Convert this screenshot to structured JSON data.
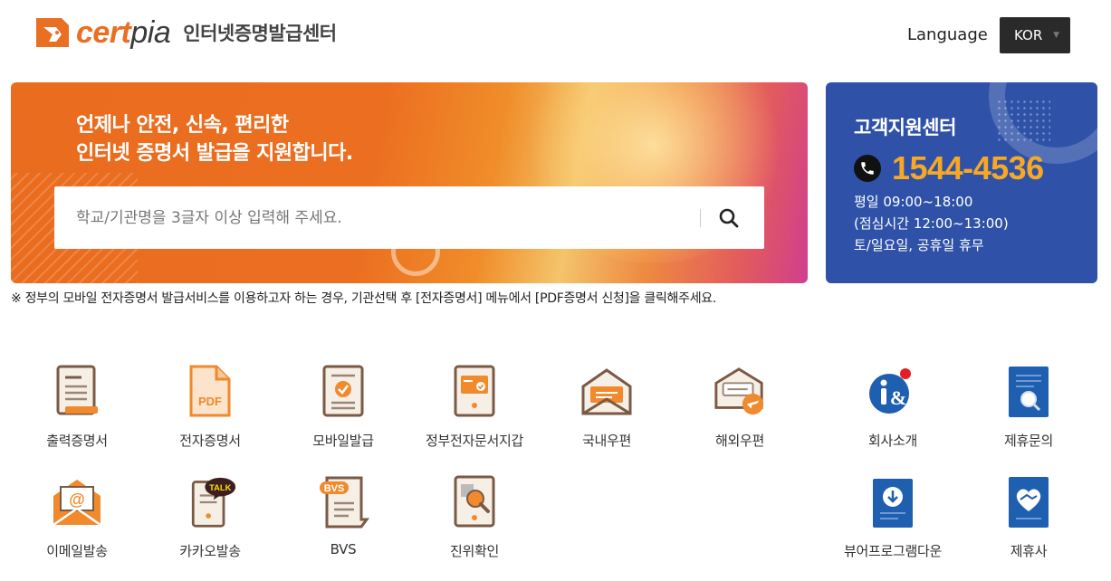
{
  "header": {
    "logo_cert": "cert",
    "logo_pia": "pia",
    "logo_subtitle": "인터넷증명발급센터",
    "language_label": "Language",
    "language_value": "KOR"
  },
  "hero": {
    "title_line1": "언제나 안전, 신속, 편리한",
    "title_line2": "인터넷 증명서 발급을 지원합니다.",
    "search_placeholder": "학교/기관명을 3글자 이상 입력해 주세요."
  },
  "customer_center": {
    "title": "고객지원센터",
    "phone": "1544-4536",
    "hours_line1": "평일 09:00~18:00",
    "hours_line2": "(점심시간 12:00~13:00)",
    "hours_line3": "토/일요일, 공휴일 휴무"
  },
  "notice": "※ 정부의 모바일 전자증명서 발급서비스를 이용하고자 하는 경우, 기관선택 후 [전자증명서] 메뉴에서 [PDF증명서 신청]을 클릭해주세요.",
  "menu": [
    {
      "label": "출력증명서",
      "icon": "printed-certificate-icon"
    },
    {
      "label": "전자증명서",
      "icon": "pdf-certificate-icon"
    },
    {
      "label": "모바일발급",
      "icon": "mobile-issue-icon"
    },
    {
      "label": "정부전자문서지갑",
      "icon": "gov-wallet-icon"
    },
    {
      "label": "국내우편",
      "icon": "domestic-mail-icon"
    },
    {
      "label": "해외우편",
      "icon": "overseas-mail-icon"
    },
    {
      "label": "회사소개",
      "icon": "company-info-icon"
    },
    {
      "label": "제휴문의",
      "icon": "partnership-inquiry-icon"
    },
    {
      "label": "이메일발송",
      "icon": "email-send-icon"
    },
    {
      "label": "카카오발송",
      "icon": "kakao-send-icon",
      "badge": "TALK"
    },
    {
      "label": "BVS",
      "icon": "bvs-icon",
      "badge": "BVS"
    },
    {
      "label": "진위확인",
      "icon": "authenticity-check-icon"
    },
    {
      "label": "뷰어프로그램다운",
      "icon": "viewer-download-icon"
    },
    {
      "label": "제휴사",
      "icon": "partners-icon"
    }
  ],
  "colors": {
    "brand_orange": "#e96f22",
    "cs_blue": "#2f52a8",
    "phone_yellow": "#f7a824",
    "icon_blue": "#1f5fb0"
  }
}
